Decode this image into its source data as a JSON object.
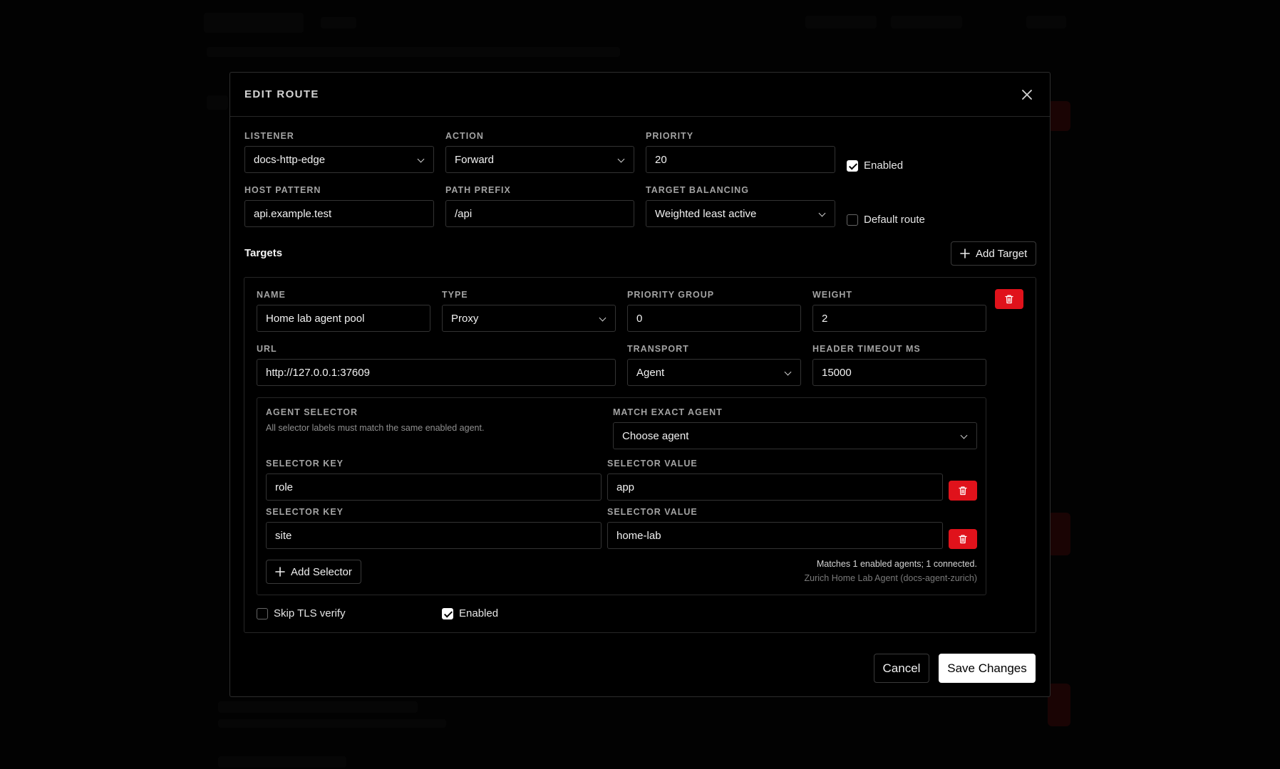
{
  "modal": {
    "title": "EDIT ROUTE",
    "listener": {
      "label": "LISTENER",
      "value": "docs-http-edge"
    },
    "action": {
      "label": "ACTION",
      "value": "Forward"
    },
    "priority": {
      "label": "PRIORITY",
      "value": "20"
    },
    "enabled": {
      "label": "Enabled",
      "checked": true
    },
    "host_pattern": {
      "label": "HOST PATTERN",
      "value": "api.example.test"
    },
    "path_prefix": {
      "label": "PATH PREFIX",
      "value": "/api"
    },
    "target_balancing": {
      "label": "TARGET BALANCING",
      "value": "Weighted least active"
    },
    "default_route": {
      "label": "Default route",
      "checked": false
    },
    "targets_title": "Targets",
    "add_target_label": "Add Target",
    "target": {
      "name": {
        "label": "NAME",
        "value": "Home lab agent pool"
      },
      "type": {
        "label": "TYPE",
        "value": "Proxy"
      },
      "priority_group": {
        "label": "PRIORITY GROUP",
        "value": "0"
      },
      "weight": {
        "label": "WEIGHT",
        "value": "2"
      },
      "url": {
        "label": "URL",
        "value": "http://127.0.0.1:37609"
      },
      "transport": {
        "label": "TRANSPORT",
        "value": "Agent"
      },
      "header_timeout": {
        "label": "HEADER TIMEOUT MS",
        "value": "15000"
      },
      "agent_selector": {
        "label": "AGENT SELECTOR",
        "hint": "All selector labels must match the same enabled agent.",
        "match_exact_label": "MATCH EXACT AGENT",
        "match_exact_value": "Choose agent",
        "key_label": "SELECTOR KEY",
        "value_label": "SELECTOR VALUE",
        "rows": [
          {
            "key": "role",
            "value": "app"
          },
          {
            "key": "site",
            "value": "home-lab"
          }
        ],
        "add_selector_label": "Add Selector",
        "match_summary": "Matches 1 enabled agents; 1 connected.",
        "match_detail": "Zurich Home Lab Agent (docs-agent-zurich)"
      },
      "skip_tls": {
        "label": "Skip TLS verify",
        "checked": false
      },
      "enabled": {
        "label": "Enabled",
        "checked": true
      }
    },
    "cancel_label": "Cancel",
    "save_label": "Save Changes"
  },
  "colors": {
    "danger": "#e0121b",
    "primary_button": "#ffffff"
  },
  "icons": {
    "close": "close-icon",
    "plus": "plus-icon",
    "trash": "trash-icon",
    "chevron": "chevron-down-icon"
  }
}
